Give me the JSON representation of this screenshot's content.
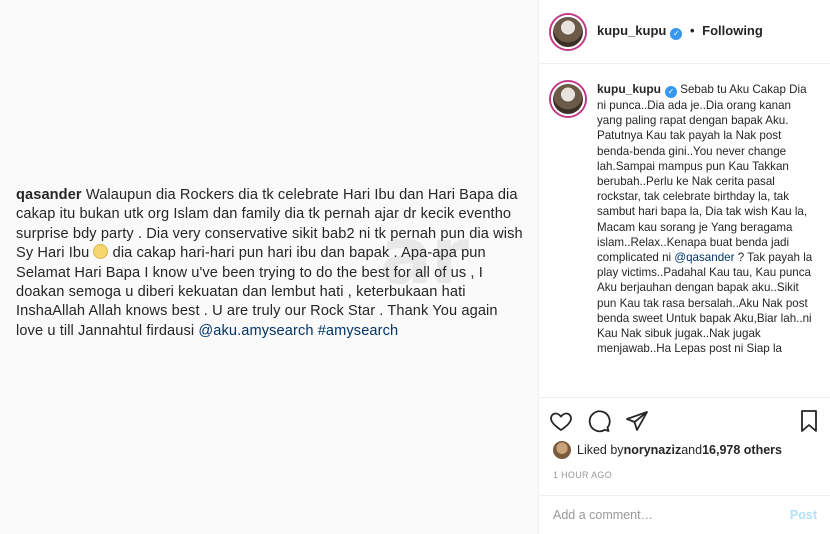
{
  "media": {
    "comment_user": "qasander",
    "comment_text_1": " Walaupun dia Rockers dia tk celebrate Hari Ibu dan Hari Bapa dia cakap itu bukan utk org Islam dan family dia tk pernah ajar dr kecik eventho surprise bdy party . Dia very conservative sikit bab2 ni tk pernah pun dia wish Sy Hari Ibu ",
    "comment_text_2": " dia cakap hari-hari pun hari ibu dan bapak . Apa-apa pun Selamat Hari Bapa I know u've been trying to do the best for all of us , I doakan semoga u diberi kekuatan dan lembut hati ,  keterbukaan hati InshaAllah Allah knows best . U are truly our Rock Star . Thank You again love u till Jannahtul firdausi ",
    "tag_1": "@aku.amysearch",
    "tag_2": "#amysearch",
    "watermark": "ar"
  },
  "header": {
    "username": "kupu_kupu",
    "separator": "•",
    "follow_status": "Following"
  },
  "caption": {
    "username": "kupu_kupu",
    "text_1": " Sebab tu Aku Cakap Dia ni punca..Dia ada je..Dia orang kanan yang paling rapat dengan bapak Aku. Patutnya Kau tak payah la Nak post benda-benda gini..You never change lah.Sampai mampus pun Kau Takkan berubah..Perlu ke Nak cerita pasal rockstar, tak celebrate birthday la, tak sambut hari bapa la, Dia tak wish Kau la, Macam kau sorang je Yang beragama islam..Relax..Kenapa buat benda jadi complicated ni ",
    "mention": "@qasander",
    "text_2": " ? Tak payah la play victims..Padahal Kau tau, Kau punca Aku berjauhan dengan bapak aku..Sikit pun Kau tak rasa bersalah..Aku Nak post benda sweet Untuk bapak Aku,Biar lah..ni Kau Nak sibuk jugak..Nak jugak menjawab..Ha Lepas post ni Siap la"
  },
  "actions": {
    "like_icon": "heart-icon",
    "comment_icon": "comment-icon",
    "share_icon": "share-icon",
    "save_icon": "bookmark-icon"
  },
  "likes": {
    "prefix": "Liked by ",
    "user": "norynaziz",
    "middle": " and ",
    "count": "16,978 others"
  },
  "time": "1 HOUR AGO",
  "comment_box": {
    "placeholder": "Add a comment…",
    "post_label": "Post"
  },
  "colors": {
    "accent": "#3897f0",
    "link": "#003569",
    "post_disabled": "#b2dffc"
  }
}
